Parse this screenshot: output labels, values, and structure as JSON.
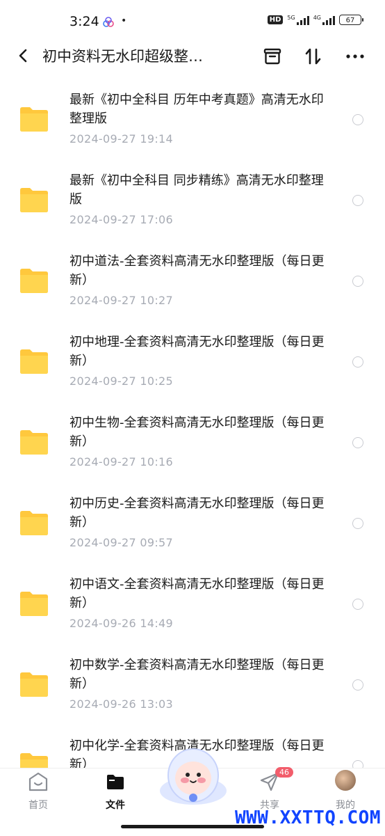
{
  "status": {
    "time": "3:24",
    "dot": "•",
    "hd": "HD",
    "net1": "5G",
    "net2": "4G",
    "battery": "67"
  },
  "header": {
    "title": "初中资料无水印超级整…",
    "icons": [
      "back-icon",
      "archive-icon",
      "sort-icon",
      "more-icon"
    ]
  },
  "files": [
    {
      "name": "最新《初中全科目 历年中考真题》高清无水印整理版",
      "date": "2024-09-27  19:14"
    },
    {
      "name": "最新《初中全科目 同步精练》高清无水印整理版",
      "date": "2024-09-27  17:06"
    },
    {
      "name": "初中道法-全套资料高清无水印整理版（每日更新）",
      "date": "2024-09-27  10:27"
    },
    {
      "name": "初中地理-全套资料高清无水印整理版（每日更新）",
      "date": "2024-09-27  10:25"
    },
    {
      "name": "初中生物-全套资料高清无水印整理版（每日更新）",
      "date": "2024-09-27  10:16"
    },
    {
      "name": "初中历史-全套资料高清无水印整理版（每日更新）",
      "date": "2024-09-27  09:57"
    },
    {
      "name": "初中语文-全套资料高清无水印整理版（每日更新）",
      "date": "2024-09-26  14:49"
    },
    {
      "name": "初中数学-全套资料高清无水印整理版（每日更新）",
      "date": "2024-09-26  13:03"
    },
    {
      "name": "初中化学-全套资料高清无水印整理版（每日更新）",
      "date": ""
    }
  ],
  "tabs": [
    {
      "label": "首页",
      "icon": "home-icon"
    },
    {
      "label": "文件",
      "icon": "folder-icon",
      "active": true
    },
    {
      "label": "共享",
      "icon": "share-icon",
      "badge": "46"
    },
    {
      "label": "我的",
      "icon": "avatar"
    }
  ],
  "watermark": "WWW.XXTTQ.COM",
  "colors": {
    "folder": "#ffc83d",
    "accent": "#111111",
    "badge": "#f25d6b",
    "date": "#a7abb4"
  }
}
